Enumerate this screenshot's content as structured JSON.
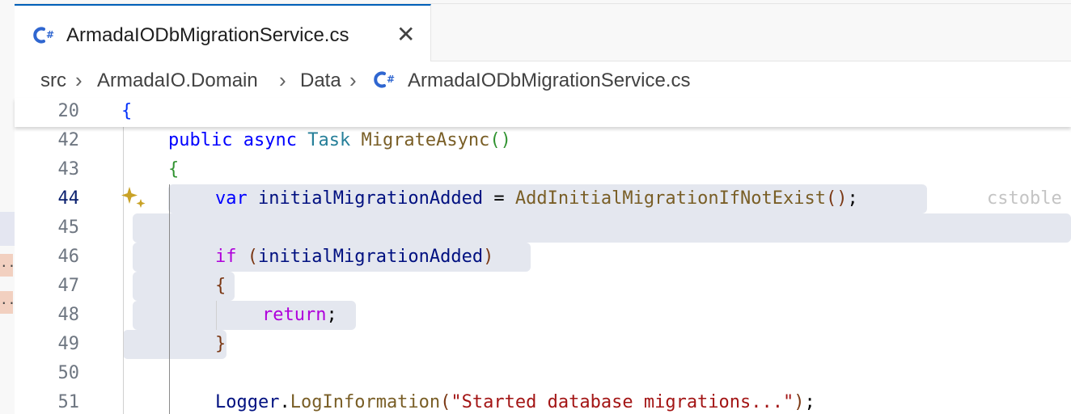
{
  "tab": {
    "title": "ArmadaIODbMigrationService.cs",
    "close_glyph": "✕"
  },
  "breadcrumb": {
    "items": [
      "src",
      "ArmadaIO.Domain",
      "Data",
      "ArmadaIODbMigrationService.cs"
    ]
  },
  "side_marks": [
    "..",
    ".."
  ],
  "editor": {
    "sticky": {
      "line": "20",
      "code": "{"
    },
    "lines": [
      {
        "n": "42",
        "tokens": [
          [
            "kw",
            "public"
          ],
          [
            "punct",
            " "
          ],
          [
            "kw",
            "async"
          ],
          [
            "punct",
            " "
          ],
          [
            "ty",
            "Task"
          ],
          [
            "punct",
            " "
          ],
          [
            "fn",
            "MigrateAsync"
          ],
          [
            "b2",
            "()"
          ]
        ]
      },
      {
        "n": "43",
        "tokens": [
          [
            "b2",
            "{"
          ]
        ]
      },
      {
        "n": "44",
        "tokens": [
          [
            "kw",
            "var"
          ],
          [
            "punct",
            " "
          ],
          [
            "var",
            "initialMigrationAdded"
          ],
          [
            "punct",
            " = "
          ],
          [
            "fn",
            "AddInitialMigrationIfNotExist"
          ],
          [
            "b3",
            "()"
          ],
          [
            "punct",
            ";"
          ]
        ]
      },
      {
        "n": "45",
        "tokens": []
      },
      {
        "n": "46",
        "tokens": [
          [
            "kw2",
            "if"
          ],
          [
            "punct",
            " "
          ],
          [
            "b3",
            "("
          ],
          [
            "var",
            "initialMigrationAdded"
          ],
          [
            "b3",
            ")"
          ]
        ]
      },
      {
        "n": "47",
        "tokens": [
          [
            "b3",
            "{"
          ]
        ]
      },
      {
        "n": "48",
        "tokens": [
          [
            "kw2",
            "return"
          ],
          [
            "punct",
            ";"
          ]
        ]
      },
      {
        "n": "49",
        "tokens": [
          [
            "b3",
            "}"
          ]
        ]
      },
      {
        "n": "50",
        "tokens": []
      },
      {
        "n": "51",
        "tokens": [
          [
            "var",
            "Logger"
          ],
          [
            "punct",
            "."
          ],
          [
            "fn",
            "LogInformation"
          ],
          [
            "b3",
            "("
          ],
          [
            "str",
            "\"Started database migrations...\""
          ],
          [
            "b3",
            ")"
          ],
          [
            "punct",
            ";"
          ]
        ]
      }
    ],
    "active_line": "44",
    "inline_hint": "cstoble",
    "sparkle_icon": "copilot-sparkle-icon"
  },
  "colors": {
    "accent": "#005fb8",
    "highlight": "#e4e7ef",
    "csharp_icon": "#2f66d0"
  }
}
